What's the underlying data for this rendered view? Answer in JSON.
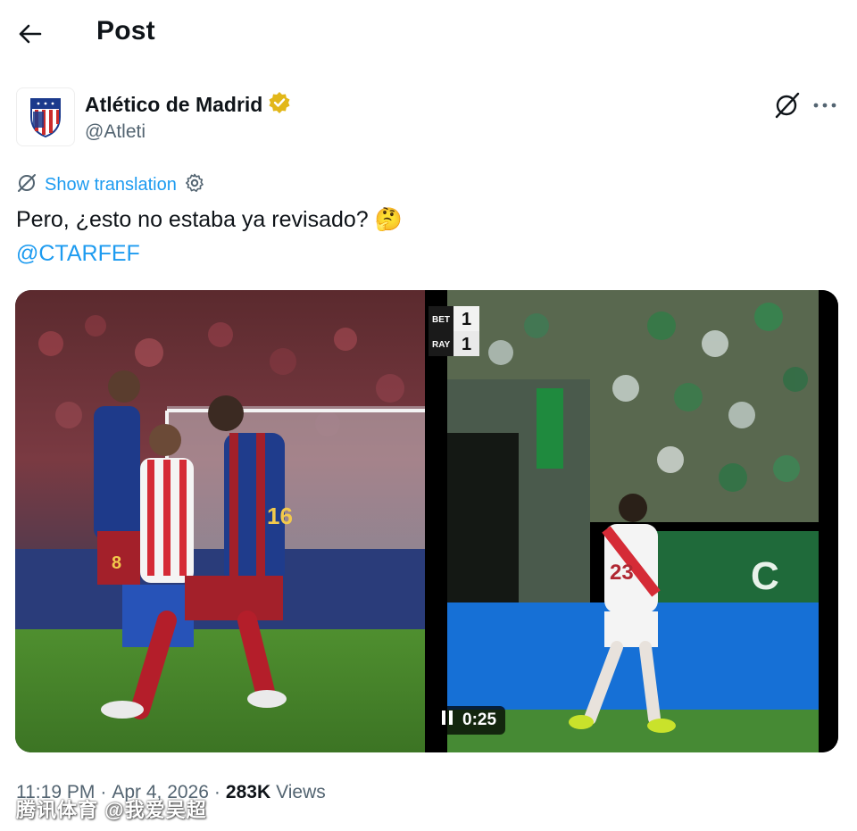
{
  "header": {
    "title": "Post"
  },
  "author": {
    "display_name": "Atlético de Madrid",
    "handle": "@Atleti",
    "verified": true
  },
  "translation": {
    "label": "Show translation"
  },
  "tweet": {
    "text": "Pero, ¿esto no estaba ya revisado? 🤔",
    "mention": "@CTARFEF"
  },
  "media": {
    "video": {
      "elapsed": "0:25",
      "score": [
        {
          "team": "BET",
          "goals": "1"
        },
        {
          "team": "RAY",
          "goals": "1"
        }
      ],
      "sponsor_text": "C"
    },
    "photo": {
      "jersey_a": "8",
      "jersey_b": "16"
    }
  },
  "meta": {
    "time": "11:19 PM",
    "separator": "·",
    "date": "Apr 4, 2026",
    "views_count": "283K",
    "views_label": "Views"
  },
  "watermark": "腾讯体育 @我爱吴超",
  "colors": {
    "link": "#1d9bf0",
    "muted": "#536471",
    "verified_badge": "#e2b719"
  }
}
